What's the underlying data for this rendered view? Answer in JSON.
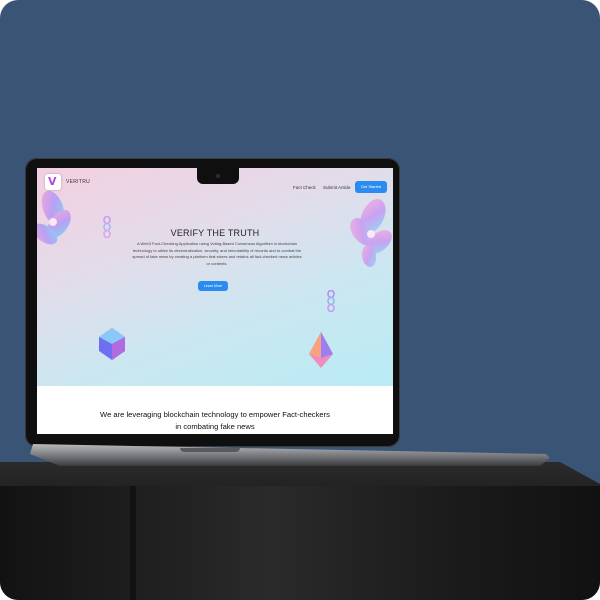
{
  "site": {
    "brand": "VERITRU",
    "logo_letter": "V",
    "nav": {
      "links": [
        "Fact Check",
        "Submit Article"
      ],
      "cta": "Get Started"
    },
    "hero": {
      "title": "VERIFY THE TRUTH",
      "description": "A Web3 Fact-Checking Application using Voting-Based Consensus Algorithm in blockchain technology to utilize its decentralization, security, and immutability of records and to combat the spread of fake news by creating a platform that stores and retains all fact-checked news articles or contents.",
      "button": "Learn More"
    },
    "band": {
      "headline": "We are leveraging blockchain technology to empower Fact-checkers in combating fake news"
    }
  },
  "colors": {
    "background": "#3a5475",
    "accent": "#2a8cf0",
    "hero_gradient_start": "#f3cfe0",
    "hero_gradient_end": "#b9ecf4"
  },
  "icons": [
    "veritru-logo-icon",
    "flower-3d-icon",
    "crystal-3d-icon",
    "chain-3d-icon"
  ]
}
